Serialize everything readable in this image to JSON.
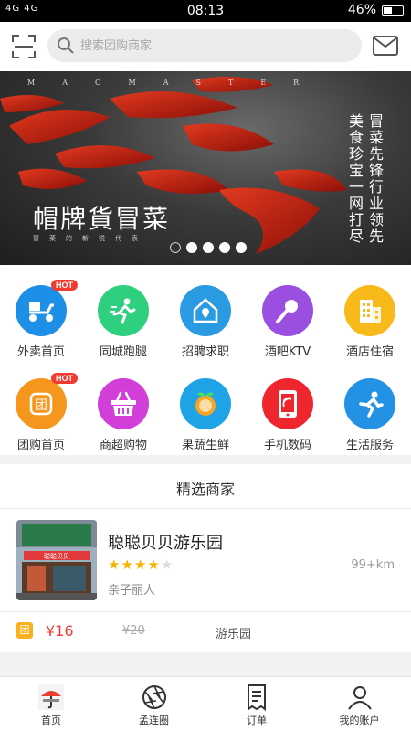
{
  "status_bar": {
    "network": "4G 4G",
    "time": "08:13",
    "battery": "46%",
    "battery_level": 0.46
  },
  "search": {
    "placeholder": "搜索团购商家"
  },
  "banner": {
    "top_text": "MAOMASTER",
    "title": "帽牌貨冒菜",
    "subtitle": "冒菜的新锐代表",
    "vertical_big_1": "冒菜先锋",
    "vertical_big_2": "美食珍宝",
    "vertical_big_3": "行业领先",
    "vertical_big_4": "一网打尽",
    "slide_count": 5,
    "active_slide": 0
  },
  "categories": [
    {
      "label": "外卖首页",
      "icon": "scooter-icon",
      "color": "#1e8fe6",
      "hot": "HOT"
    },
    {
      "label": "同城跑腿",
      "icon": "runner-icon",
      "color": "#2ecf7f"
    },
    {
      "label": "招聘求职",
      "icon": "house-pin-icon",
      "color": "#2a9ae3"
    },
    {
      "label": "酒吧KTV",
      "icon": "microphone-icon",
      "color": "#9b4fe0"
    },
    {
      "label": "酒店住宿",
      "icon": "building-icon",
      "color": "#f8b91a"
    },
    {
      "label": "团购首页",
      "icon": "group-buy-icon",
      "color": "#f7961d",
      "hot": "HOT"
    },
    {
      "label": "商超购物",
      "icon": "basket-icon",
      "color": "#d13fd8"
    },
    {
      "label": "果蔬生鲜",
      "icon": "orange-icon",
      "color": "#1ea3e6"
    },
    {
      "label": "手机数码",
      "icon": "phone-icon",
      "color": "#f0262f"
    },
    {
      "label": "生活服务",
      "icon": "running-man-icon",
      "color": "#2392e5"
    }
  ],
  "featured": {
    "title": "精选商家",
    "shop": {
      "name": "聪聪贝贝游乐园",
      "rating": 4,
      "rating_max": 5,
      "tag": "亲子丽人",
      "distance": "99+km",
      "deal_badge": "团",
      "price": "¥16",
      "old_price": "¥20",
      "deal_category": "游乐园",
      "sign_text": "聪聪贝贝"
    }
  },
  "tabbar": [
    {
      "label": "首页",
      "icon": "umbrella-home-icon"
    },
    {
      "label": "孟连圈",
      "icon": "aperture-icon"
    },
    {
      "label": "订单",
      "icon": "order-document-icon"
    },
    {
      "label": "我的账户",
      "icon": "user-account-icon"
    }
  ]
}
